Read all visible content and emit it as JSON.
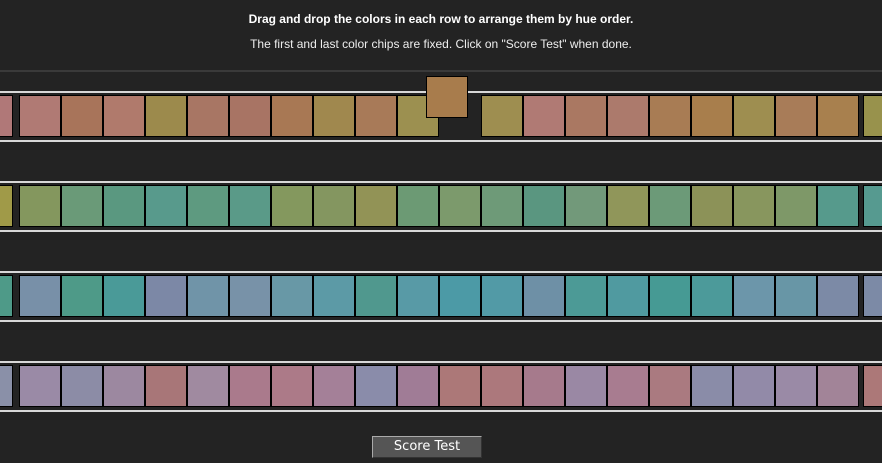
{
  "instructions": {
    "title": "Drag and drop the colors in each row to arrange them by hue order.",
    "subtitle": "The first and last color chips are fixed. Click on \"Score Test\" when done."
  },
  "score_button": "Score Test",
  "dragged_chip": "#a87c4c",
  "rows": [
    {
      "fixed_left": "#b07878",
      "fixed_right": "#98924c",
      "gap_index": 10,
      "chips": [
        "#b07a74",
        "#a8745a",
        "#b07a6c",
        "#9c8a4c",
        "#a87664",
        "#a87464",
        "#a87854",
        "#a0884e",
        "#a87a58",
        "#9c9050",
        "#9e8e50",
        "#b07a74",
        "#aa7862",
        "#ac7a6c",
        "#a87c54",
        "#a87e4c",
        "#9e8e50",
        "#a87c58",
        "#a8804e"
      ]
    },
    {
      "fixed_left": "#a09a48",
      "fixed_right": "#569a90",
      "chips": [
        "#84975e",
        "#6a9a78",
        "#5a9880",
        "#589a8c",
        "#5e9a80",
        "#5a9a88",
        "#84985e",
        "#849660",
        "#929356",
        "#6c9a74",
        "#7c9a6c",
        "#6e9a78",
        "#5a9680",
        "#72997a",
        "#90965a",
        "#6c9a78",
        "#8c9258",
        "#88965e",
        "#7e9868",
        "#569a8c"
      ]
    },
    {
      "fixed_left": "#4e9a88",
      "fixed_right": "#7c8aa6",
      "chips": [
        "#7890a8",
        "#4e9a88",
        "#4a9a98",
        "#7c88a6",
        "#7094a8",
        "#7892a8",
        "#6898a6",
        "#5c9aa6",
        "#50988e",
        "#589aa6",
        "#4c9aa6",
        "#529aa6",
        "#6e90a6",
        "#4c9a96",
        "#509aa0",
        "#469a94",
        "#4c9a9a",
        "#6c96aa",
        "#6896a6",
        "#7c8aa6"
      ]
    },
    {
      "fixed_left": "#8a90a8",
      "fixed_right": "#ac7878",
      "chips": [
        "#9a8aa6",
        "#8c8ca6",
        "#9c88a0",
        "#a87678",
        "#a08aa0",
        "#aa7a8c",
        "#ac7a88",
        "#a48098",
        "#8a8caa",
        "#a07c96",
        "#ac7878",
        "#ac787c",
        "#a67a8c",
        "#9a88a4",
        "#a87c90",
        "#aa7a80",
        "#8a8ca8",
        "#928aa8",
        "#9a8aa6",
        "#a28498"
      ]
    }
  ]
}
